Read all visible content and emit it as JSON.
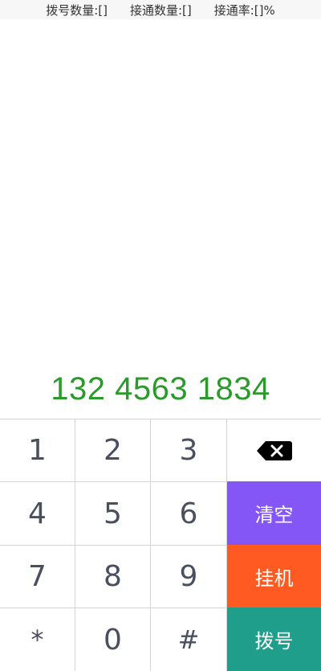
{
  "stats": {
    "dial_count": "拨号数量:[]",
    "connected_count": "接通数量:[]",
    "connect_rate": "接通率:[]%"
  },
  "display": {
    "number": "132 4563 1834",
    "color": "#2a9a2a"
  },
  "keypad": {
    "keys": [
      "1",
      "2",
      "3",
      "4",
      "5",
      "6",
      "7",
      "8",
      "9",
      "*",
      "0",
      "#"
    ],
    "backspace_icon": "backspace-icon",
    "clear_label": "清空",
    "hangup_label": "挂机",
    "dial_label": "拨号",
    "colors": {
      "clear": "#8456f6",
      "hangup": "#ff5a22",
      "dial": "#1f9e8c"
    }
  }
}
